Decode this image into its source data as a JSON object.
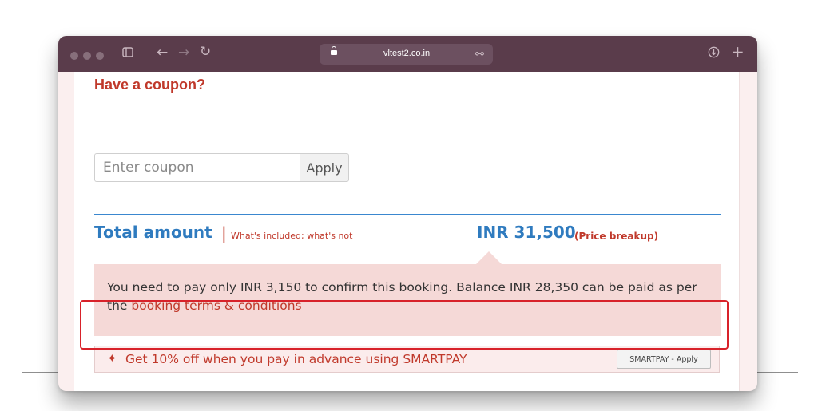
{
  "browser": {
    "url": "vltest2.co.in",
    "icons": [
      "sidebar-icon",
      "back-icon",
      "forward-icon",
      "reload-icon",
      "lock-icon",
      "link-icon",
      "download-icon",
      "new-tab-icon"
    ]
  },
  "coupon": {
    "heading": "Have a coupon?",
    "placeholder": "Enter coupon",
    "apply_label": "Apply"
  },
  "total": {
    "label": "Total amount",
    "separator": "|",
    "included_link": "What's included; what's not",
    "amount": "INR 31,500",
    "breakup_link": "(Price breakup)"
  },
  "payment_note": {
    "text": "You need to pay only INR 3,150 to confirm this booking. Balance INR 28,350 can be paid as per the ",
    "link": "booking terms & conditions"
  },
  "smartpay": {
    "icon": "sparkle-icon",
    "text": "Get 10% off when you pay in advance using SMARTPAY",
    "button_label": "SMARTPAY - Apply"
  },
  "colors": {
    "accent_red": "#c0392b",
    "accent_blue": "#2f7bbf",
    "highlight_border": "#d8222a",
    "note_background": "#f5d9d7"
  }
}
